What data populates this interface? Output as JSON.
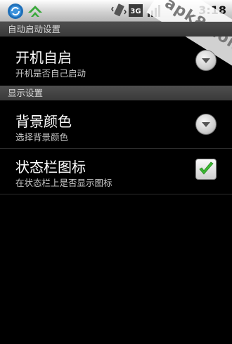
{
  "status_bar": {
    "clock": "3:18",
    "network": "3G",
    "icons": [
      "sync-icon",
      "app-notification-icon",
      "vibrate-icon",
      "3g-icon",
      "signal-icon",
      "battery-icon"
    ]
  },
  "watermark": "apk8.com",
  "sections": [
    {
      "header": "自动启动设置",
      "items": [
        {
          "title": "开机自启",
          "summary": "开机是否自己启动",
          "control": "dropdown"
        }
      ]
    },
    {
      "header": "显示设置",
      "items": [
        {
          "title": "背景颜色",
          "summary": "选择背景颜色",
          "control": "dropdown"
        },
        {
          "title": "状态栏图标",
          "summary": "在状态栏上是否显示图标",
          "control": "checkbox",
          "checked": true
        }
      ]
    }
  ],
  "colors": {
    "background": "#000000",
    "section_header": "#444444",
    "check_green": "#3cb832"
  }
}
